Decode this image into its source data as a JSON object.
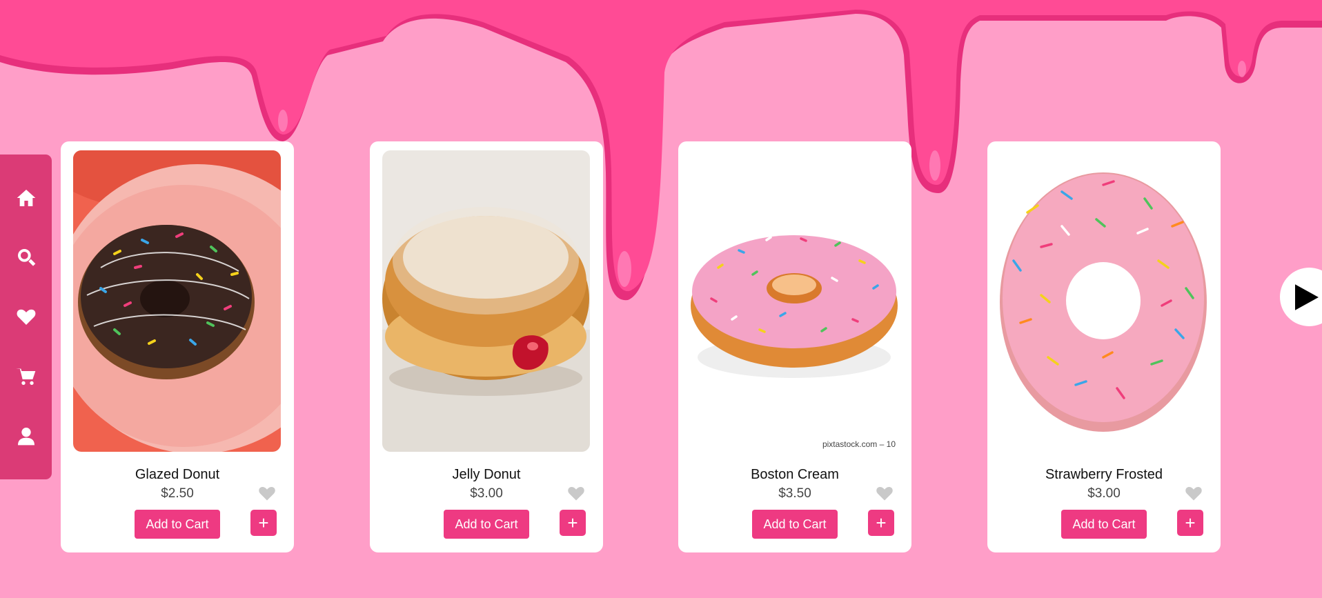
{
  "sidebar": {
    "items": [
      {
        "icon": "home-icon"
      },
      {
        "icon": "search-icon"
      },
      {
        "icon": "heart-icon"
      },
      {
        "icon": "cart-icon"
      },
      {
        "icon": "user-icon"
      }
    ]
  },
  "colors": {
    "background": "#ff9ec8",
    "sidebar": "#db3b76",
    "accent": "#ee3a82",
    "drip": "#ff3f8f"
  },
  "products": [
    {
      "name": "Glazed Donut",
      "price": "$2.50",
      "add_label": "Add to Cart",
      "plus_label": "+"
    },
    {
      "name": "Jelly Donut",
      "price": "$3.00",
      "add_label": "Add to Cart",
      "plus_label": "+"
    },
    {
      "name": "Boston Cream",
      "price": "$3.50",
      "add_label": "Add to Cart",
      "plus_label": "+",
      "watermark": "pixtastock.com – 10"
    },
    {
      "name": "Strawberry Frosted",
      "price": "$3.00",
      "add_label": "Add to Cart",
      "plus_label": "+"
    }
  ],
  "carousel": {
    "next_icon": "play-right-icon"
  }
}
